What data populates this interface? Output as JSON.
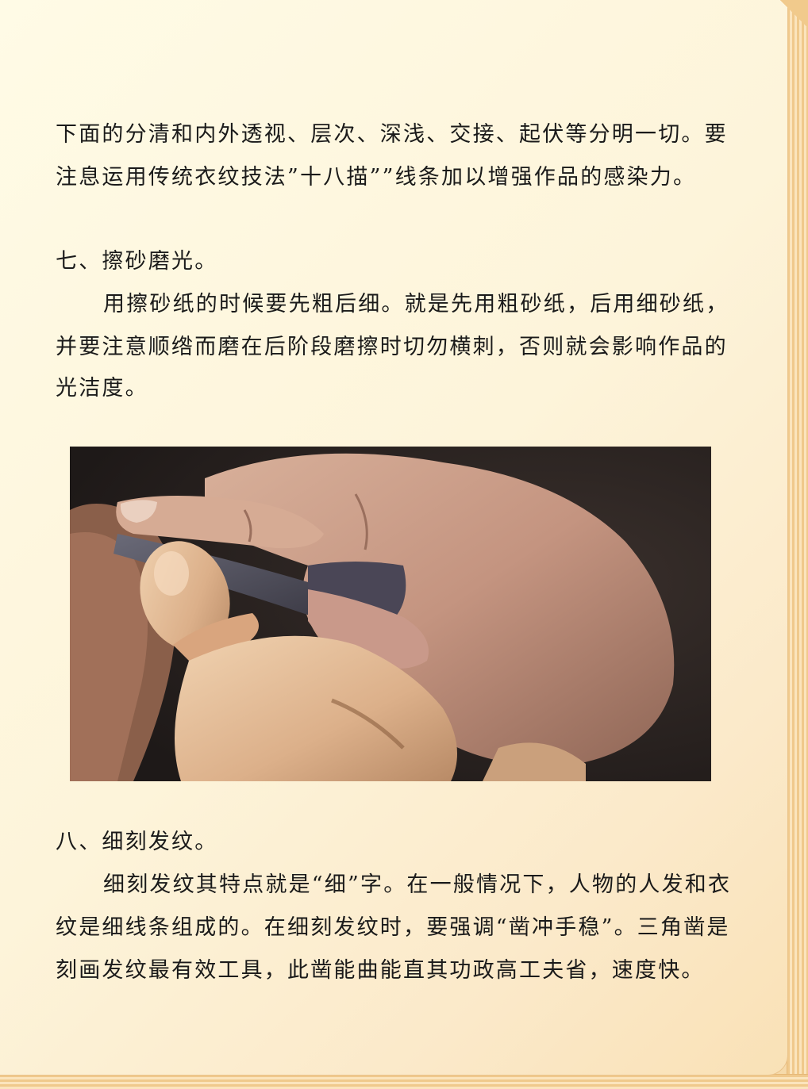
{
  "para1": {
    "line1": "下面的分清和内外透视、层次、深浅、交接、起伏等分明一切。要",
    "line2": "注息运用传统衣纹技法”十八描””线条加以增强作品的感染力。"
  },
  "section7": {
    "heading": "七、擦砂磨光。",
    "line1": "用擦砂纸的时候要先粗后细。就是先用粗砂纸，后用细砂纸，",
    "line2": "并要注意顺绺而磨在后阶段磨擦时切勿横刺，否则就会影响作品的",
    "line3": "光洁度。"
  },
  "section8": {
    "heading": "八、细刻发纹。",
    "line1": "细刻发纹其特点就是“细”字。在一般情况下，人物的人发和衣",
    "line2": "纹是细线条组成的。在细刻发纹时，要强调“凿冲手稳”。三角凿是",
    "line3": "刻画发纹最有效工具，此凿能曲能直其功政高工夫省，速度快。"
  },
  "colors": {
    "text": "#1a1a1a",
    "page": "#fdf4da",
    "edge": "#f0c98c"
  }
}
